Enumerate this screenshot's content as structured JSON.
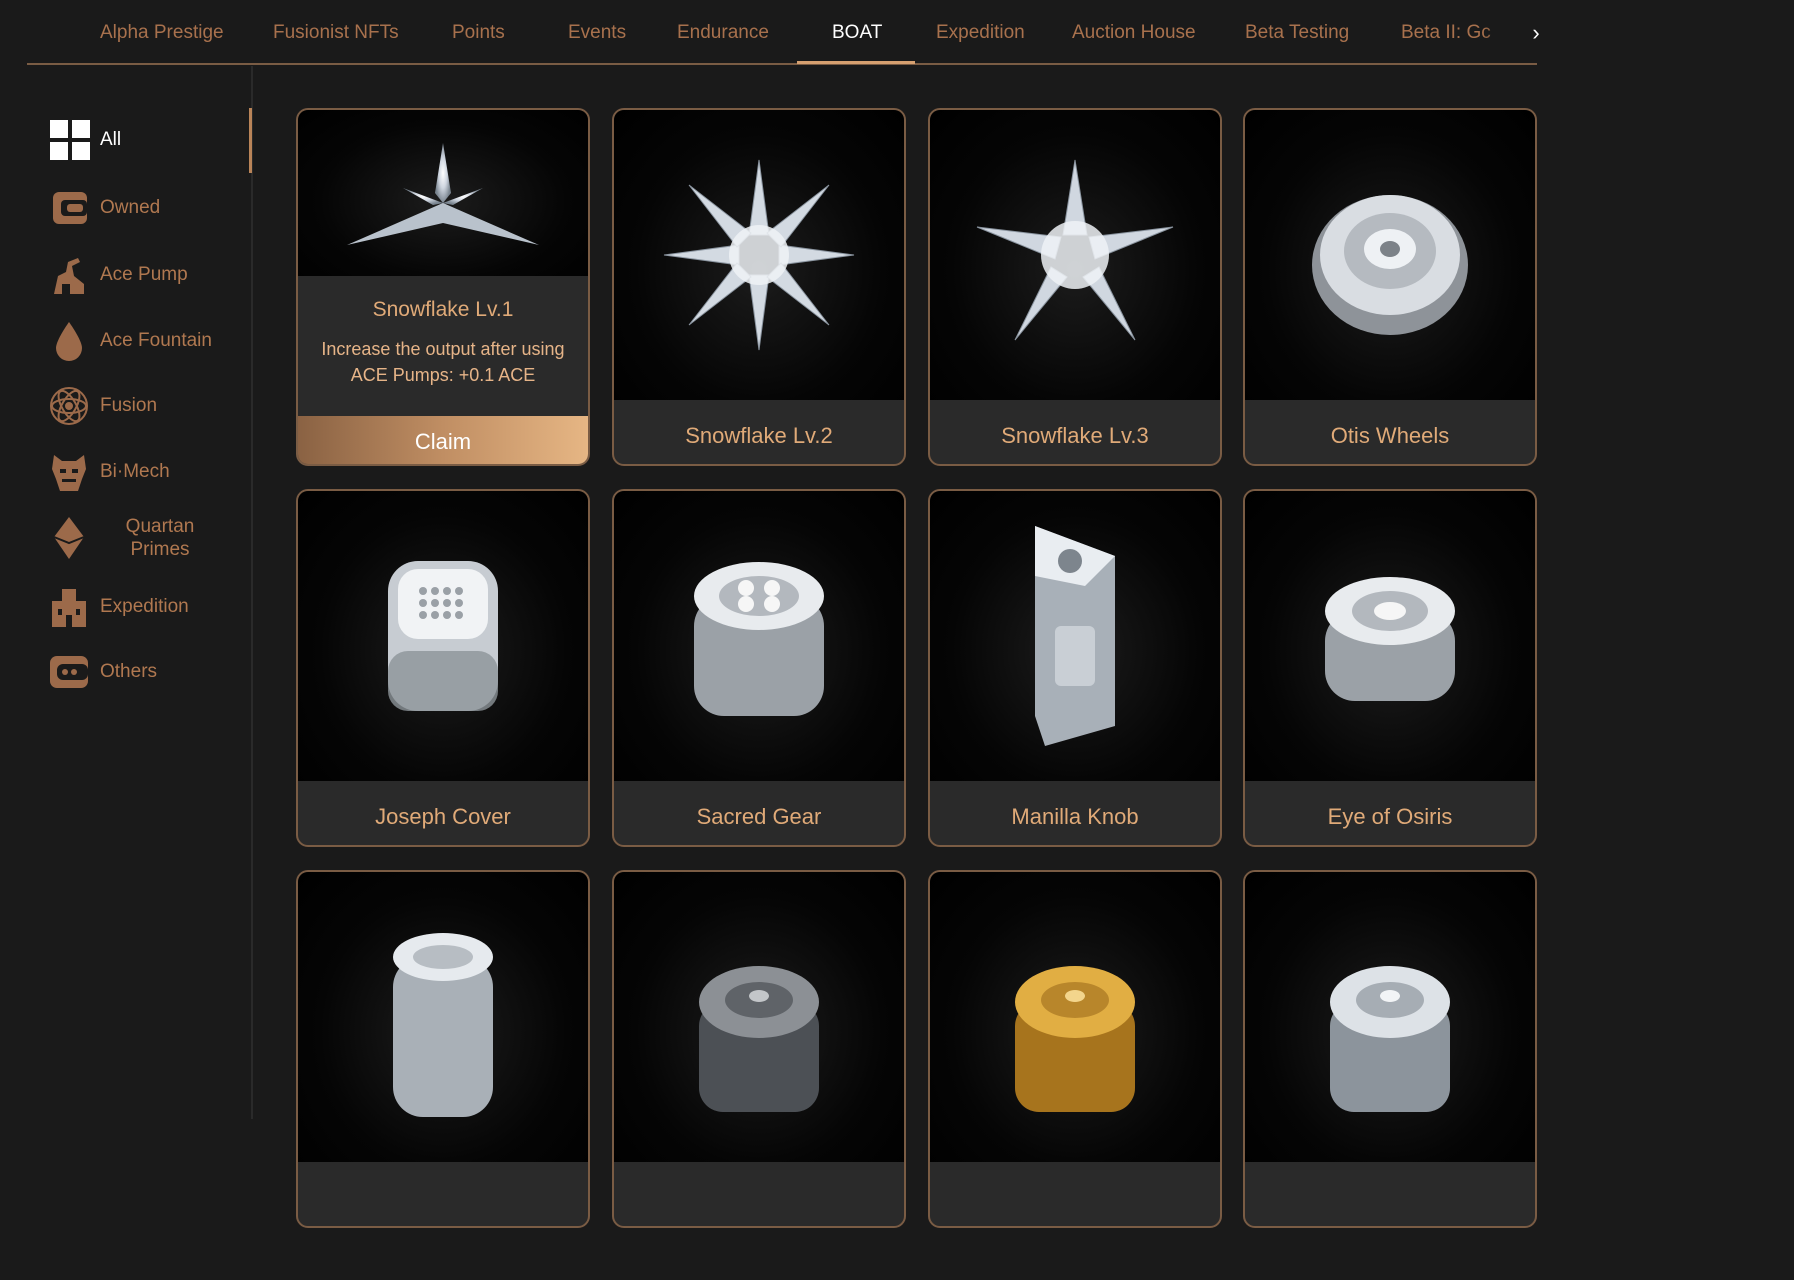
{
  "tabs": [
    {
      "label": "Alpha Prestige",
      "active": false
    },
    {
      "label": "Fusionist NFTs",
      "active": false
    },
    {
      "label": "Points",
      "active": false
    },
    {
      "label": "Events",
      "active": false
    },
    {
      "label": "Endurance",
      "active": false
    },
    {
      "label": "BOAT",
      "active": true
    },
    {
      "label": "Expedition",
      "active": false
    },
    {
      "label": "Auction House",
      "active": false
    },
    {
      "label": "Beta Testing",
      "active": false
    },
    {
      "label": "Beta II: Gc",
      "active": false
    }
  ],
  "sidebar": {
    "items": [
      {
        "label": "All",
        "icon": "grid-icon",
        "active": true
      },
      {
        "label": "Owned",
        "icon": "wallet-icon",
        "active": false
      },
      {
        "label": "Ace Pump",
        "icon": "pump-icon",
        "active": false
      },
      {
        "label": "Ace Fountain",
        "icon": "droplet-icon",
        "active": false
      },
      {
        "label": "Fusion",
        "icon": "atom-icon",
        "active": false
      },
      {
        "label": "Bi·Mech",
        "icon": "mech-icon",
        "active": false
      },
      {
        "label": "Quartan Primes",
        "icon": "diamond-icon",
        "active": false
      },
      {
        "label": "Expedition",
        "icon": "expedition-icon",
        "active": false
      },
      {
        "label": "Others",
        "icon": "others-icon",
        "active": false
      }
    ]
  },
  "cards": [
    {
      "name": "Snowflake Lv.1",
      "description": "Increase the output after using ACE Pumps: +0.1 ACE",
      "action": "Claim",
      "expanded": true,
      "art": "snowflake"
    },
    {
      "name": "Snowflake Lv.2",
      "art": "snowflake"
    },
    {
      "name": "Snowflake Lv.3",
      "art": "snowflake"
    },
    {
      "name": "Otis Wheels",
      "art": "wheel"
    },
    {
      "name": "Joseph Cover",
      "art": "cover"
    },
    {
      "name": "Sacred Gear",
      "art": "gear"
    },
    {
      "name": "Manilla Knob",
      "art": "knob"
    },
    {
      "name": "Eye of Osiris",
      "art": "gear"
    },
    {
      "name": "",
      "art": "cylinder-glass"
    },
    {
      "name": "",
      "art": "cylinder-silver"
    },
    {
      "name": "",
      "art": "cylinder-gold"
    },
    {
      "name": "",
      "art": "cylinder-rainbow"
    }
  ],
  "colors": {
    "background": "#1a1a1a",
    "accent": "#d6a070",
    "border": "#7a5c44",
    "text_muted": "#a8714d"
  }
}
